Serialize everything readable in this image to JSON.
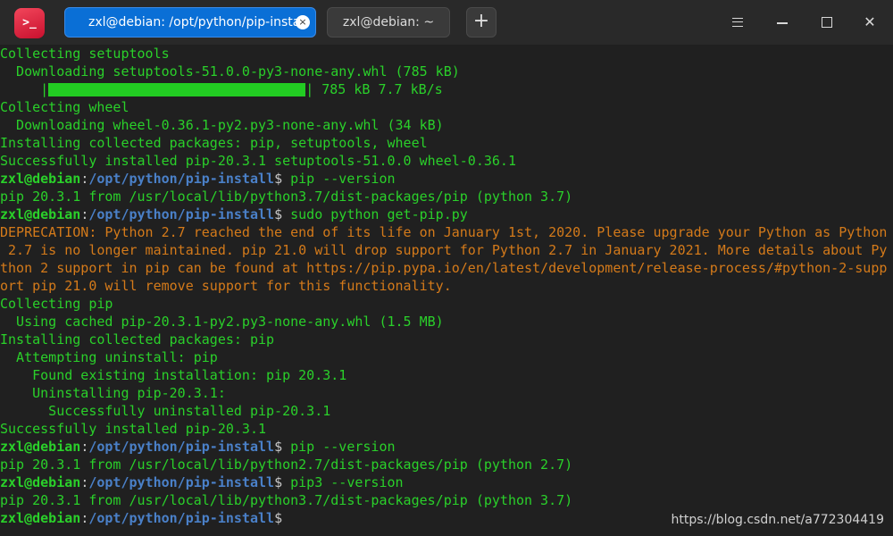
{
  "titlebar": {
    "app_icon": "terminal-icon",
    "app_icon_glyph": ">_",
    "tabs": [
      {
        "label": "zxl@debian: /opt/python/pip-install",
        "active": true
      },
      {
        "label": "zxl@debian: ~",
        "active": false
      }
    ],
    "new_tab_glyph": "+",
    "close_glyph": "×"
  },
  "colors": {
    "background": "#202020",
    "output": "#2ad02a",
    "warning": "#d47a1a",
    "path": "#4a80c8",
    "tab_active": "#0a6fd6"
  },
  "terminal": {
    "lines": [
      {
        "text": "Collecting setuptools"
      },
      {
        "text": "  Downloading setuptools-51.0.0-py3-none-any.whl (785 kB)"
      },
      {
        "progress": true,
        "prefix": "     |",
        "suffix": "| 785 kB 7.7 kB/s",
        "fraction": 1.0
      },
      {
        "text": "Collecting wheel"
      },
      {
        "text": "  Downloading wheel-0.36.1-py2.py3-none-any.whl (34 kB)"
      },
      {
        "text": "Installing collected packages: pip, setuptools, wheel"
      },
      {
        "text": "Successfully installed pip-20.3.1 setuptools-51.0.0 wheel-0.36.1"
      },
      {
        "prompt": true,
        "user": "zxl@debian",
        "sep": ":",
        "path": "/opt/python/pip-install",
        "sign": "$",
        "cmd": " pip --version"
      },
      {
        "text": "pip 20.3.1 from /usr/local/lib/python3.7/dist-packages/pip (python 3.7)"
      },
      {
        "prompt": true,
        "user": "zxl@debian",
        "sep": ":",
        "path": "/opt/python/pip-install",
        "sign": "$",
        "cmd": " sudo python get-pip.py"
      },
      {
        "text": "DEPRECATION: Python 2.7 reached the end of its life on January 1st, 2020. Please upgrade your Python as Python",
        "warn": true
      },
      {
        "text": " 2.7 is no longer maintained. pip 21.0 will drop support for Python 2.7 in January 2021. More details about Py",
        "warn": true
      },
      {
        "text": "thon 2 support in pip can be found at https://pip.pypa.io/en/latest/development/release-process/#python-2-supp",
        "warn": true
      },
      {
        "text": "ort pip 21.0 will remove support for this functionality.",
        "warn": true
      },
      {
        "text": "Collecting pip"
      },
      {
        "text": "  Using cached pip-20.3.1-py2.py3-none-any.whl (1.5 MB)"
      },
      {
        "text": "Installing collected packages: pip"
      },
      {
        "text": "  Attempting uninstall: pip"
      },
      {
        "text": "    Found existing installation: pip 20.3.1"
      },
      {
        "text": "    Uninstalling pip-20.3.1:"
      },
      {
        "text": "      Successfully uninstalled pip-20.3.1"
      },
      {
        "text": "Successfully installed pip-20.3.1"
      },
      {
        "prompt": true,
        "user": "zxl@debian",
        "sep": ":",
        "path": "/opt/python/pip-install",
        "sign": "$",
        "cmd": " pip --version"
      },
      {
        "text": "pip 20.3.1 from /usr/local/lib/python2.7/dist-packages/pip (python 2.7)"
      },
      {
        "prompt": true,
        "user": "zxl@debian",
        "sep": ":",
        "path": "/opt/python/pip-install",
        "sign": "$",
        "cmd": " pip3 --version"
      },
      {
        "text": "pip 20.3.1 from /usr/local/lib/python3.7/dist-packages/pip (python 3.7)"
      },
      {
        "prompt": true,
        "user": "zxl@debian",
        "sep": ":",
        "path": "/opt/python/pip-install",
        "sign": "$",
        "cmd": ""
      }
    ]
  },
  "watermark": "https://blog.csdn.net/a772304419"
}
